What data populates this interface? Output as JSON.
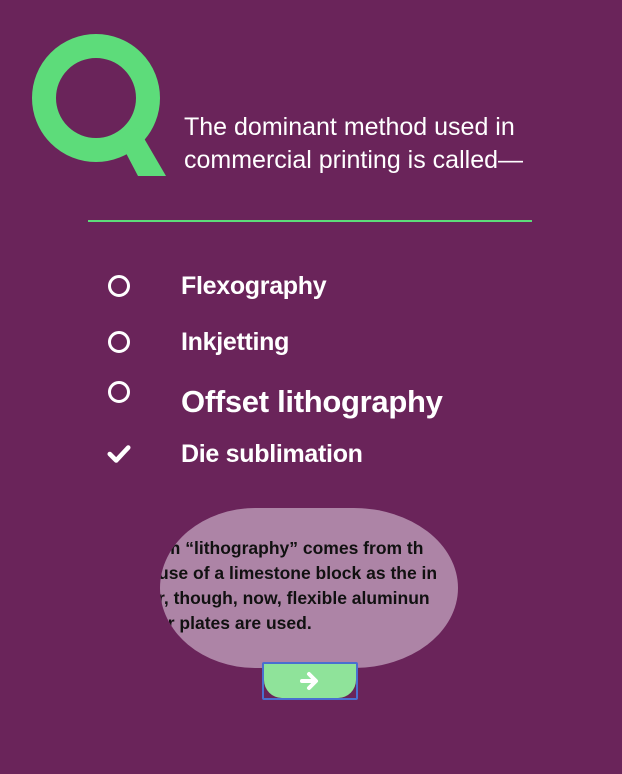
{
  "question": {
    "letter": "Q",
    "text": "The dominant method used in commercial printing is called—"
  },
  "options": [
    {
      "label": "Flexography",
      "selected": false,
      "marker_icon": "ring-icon"
    },
    {
      "label": "Inkjetting",
      "selected": false,
      "marker_icon": "ring-icon"
    },
    {
      "label": "Offset lithography",
      "selected": false,
      "marker_icon": "ring-icon"
    },
    {
      "label": "Die sublimation",
      "selected": true,
      "marker_icon": "checkmark-icon"
    }
  ],
  "explanation": {
    "lines": [
      "rm “lithography” comes from th",
      "use of a limestone block as the in",
      "r, though, now, flexible aluminun",
      "er plates are used."
    ]
  },
  "next_button": {
    "icon": "arrow-right-icon"
  },
  "colors": {
    "background": "#6a245a",
    "accent": "#5ddc7a",
    "bubble": "#ad84a6",
    "button": "#8fe39a",
    "text": "#ffffff"
  }
}
